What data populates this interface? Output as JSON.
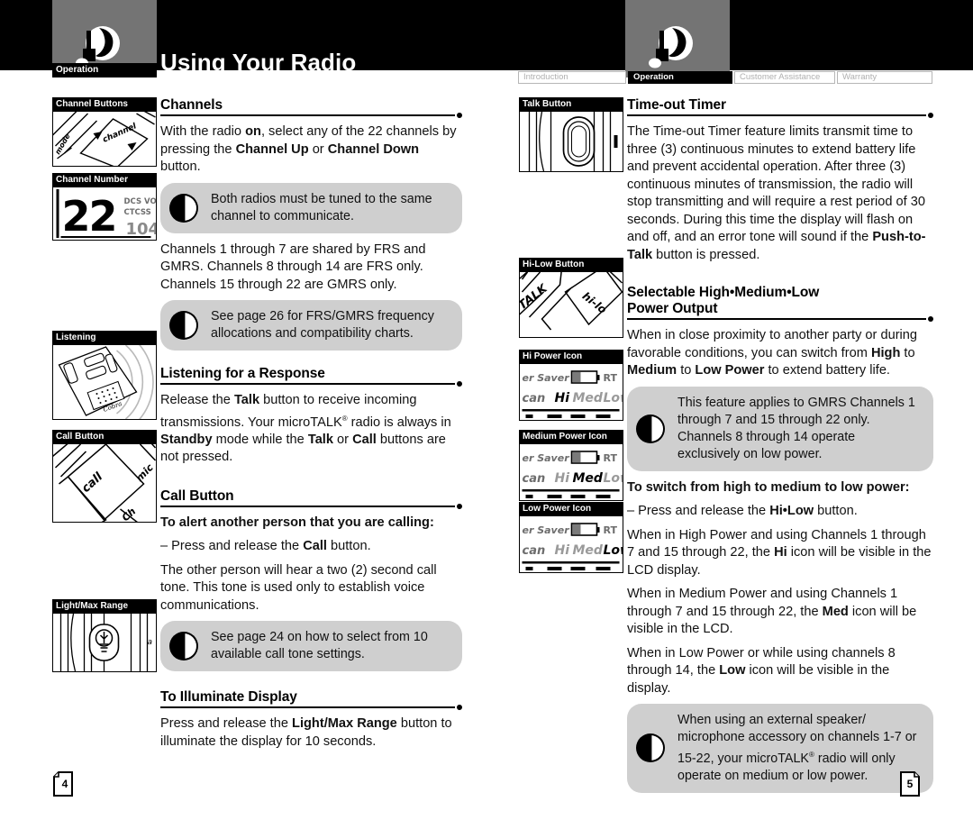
{
  "header": {
    "title": "Using Your Radio",
    "left_logo_caption": "Operation",
    "tabs": [
      {
        "label": "Introduction",
        "active": false
      },
      {
        "label": "Operation",
        "active": true
      },
      {
        "label": "Customer Assistance",
        "active": false
      },
      {
        "label": "Warranty",
        "active": false
      }
    ]
  },
  "left_page": {
    "page_number": "4",
    "figures": [
      {
        "caption": "Channel Buttons",
        "labels": [
          "channel",
          "mode"
        ]
      },
      {
        "caption": "Channel Number",
        "labels": [
          "22",
          "DCS VO",
          "CTCSS"
        ]
      },
      {
        "caption": "Listening",
        "labels": []
      },
      {
        "caption": "Call Button",
        "labels": [
          "call",
          "mic"
        ]
      },
      {
        "caption": "Light/Max Range",
        "labels": []
      }
    ],
    "sections": [
      {
        "heading": "Channels",
        "blocks": [
          {
            "type": "p",
            "html": "With the radio <b>on</b>, select any of the 22 channels by pressing the <b>Channel Up</b> or <b>Channel Down</b> button."
          },
          {
            "type": "note",
            "html": "Both radios must be tuned to the same channel to communicate."
          },
          {
            "type": "p",
            "html": "Channels 1 through 7 are shared by FRS and GMRS. Channels 8 through 14 are FRS only. Channels 15 through 22 are GMRS only."
          },
          {
            "type": "note",
            "html": "See page 26 for FRS/GMRS frequency allocations and compatibility charts."
          }
        ]
      },
      {
        "heading": "Listening for a Response",
        "blocks": [
          {
            "type": "p",
            "html": "Release the <b>Talk</b> button to receive incoming transmissions. Your microTALK<span class=\"sup\">&reg;</span> radio is always in <b>Standby</b> mode while the <b>Talk</b> or <b>Call</b> buttons are not pressed."
          }
        ]
      },
      {
        "heading": "Call Button",
        "blocks": [
          {
            "type": "p",
            "html": "<b>To alert another person that you are calling:</b>"
          },
          {
            "type": "p",
            "html": "&ndash; Press and release the <b>Call</b> button."
          },
          {
            "type": "p",
            "html": "The other person will hear a two (2) second call tone. This tone is used only to establish voice communications."
          },
          {
            "type": "note",
            "html": "See page 24 on how to select from 10 available call tone settings."
          }
        ]
      },
      {
        "heading": "To Illuminate Display",
        "blocks": [
          {
            "type": "p",
            "html": "Press and release the <b>Light/Max Range</b> button to illuminate the display for 10 seconds."
          }
        ]
      }
    ]
  },
  "right_page": {
    "page_number": "5",
    "figures": [
      {
        "caption": "Talk Button",
        "labels": []
      },
      {
        "caption": "Hi-Low Button",
        "labels": [
          "TALK",
          "hi-lo"
        ]
      },
      {
        "caption": "Hi Power Icon",
        "labels": [
          "er Saver",
          "RT",
          "can",
          "Hi",
          "Med",
          "Low"
        ],
        "highlight": "Hi"
      },
      {
        "caption": "Medium Power Icon",
        "labels": [
          "er Saver",
          "RT",
          "can",
          "Hi",
          "Med",
          "Low"
        ],
        "highlight": "Med"
      },
      {
        "caption": "Low Power Icon",
        "labels": [
          "er Saver",
          "RT",
          "can",
          "Hi",
          "Med",
          "Low"
        ],
        "highlight": "Low"
      }
    ],
    "sections": [
      {
        "heading": "Time-out Timer",
        "heading2": "",
        "blocks": [
          {
            "type": "p",
            "html": "The Time-out Timer feature limits transmit time to three (3) continuous minutes to extend battery life and prevent accidental operation. After three (3) continuous minutes of transmission, the radio will stop transmitting and will require a rest period of 30 seconds. During this time the display will flash on and off, and an error tone will sound if the <b>Push-to-Talk</b> button is pressed."
          }
        ]
      },
      {
        "heading": "Selectable High•Medium•Low",
        "heading2": "Power Output",
        "blocks": [
          {
            "type": "p",
            "html": "When in close proximity to another party or during favorable conditions, you can switch from <b>High</b> to <b>Medium</b> to <b>Low Power</b> to extend battery life."
          },
          {
            "type": "note",
            "html": "This feature applies to GMRS Channels 1 through 7 and 15 through 22 only. Channels 8 through 14 operate exclusively on low power."
          },
          {
            "type": "p",
            "html": "<b>To switch from high to medium to low power:</b>"
          },
          {
            "type": "p",
            "html": "&ndash; Press and release the <b>Hi&bull;Low</b> button."
          },
          {
            "type": "p",
            "html": "When in High Power and using Channels 1 through 7 and 15 through 22, the <b>Hi</b> icon will be visible in the LCD display."
          },
          {
            "type": "p",
            "html": "When in Medium Power and using Channels 1 through 7 and 15 through 22, the <b>Med</b> icon will be visible in the LCD."
          },
          {
            "type": "p",
            "html": "When in Low Power or while using channels 8 through 14, the <b>Low</b> icon will be visible in the display."
          },
          {
            "type": "note",
            "html": "When using an external speaker/ microphone accessory on channels 1-7 or 15-22, your microTALK<span class=\"sup\">&reg;</span> radio will only operate on medium or low power."
          }
        ]
      }
    ]
  },
  "colors": {
    "band": "#000000",
    "logo_block": "#747474",
    "note_bg": "#cfcfcf",
    "text": "#111111"
  }
}
